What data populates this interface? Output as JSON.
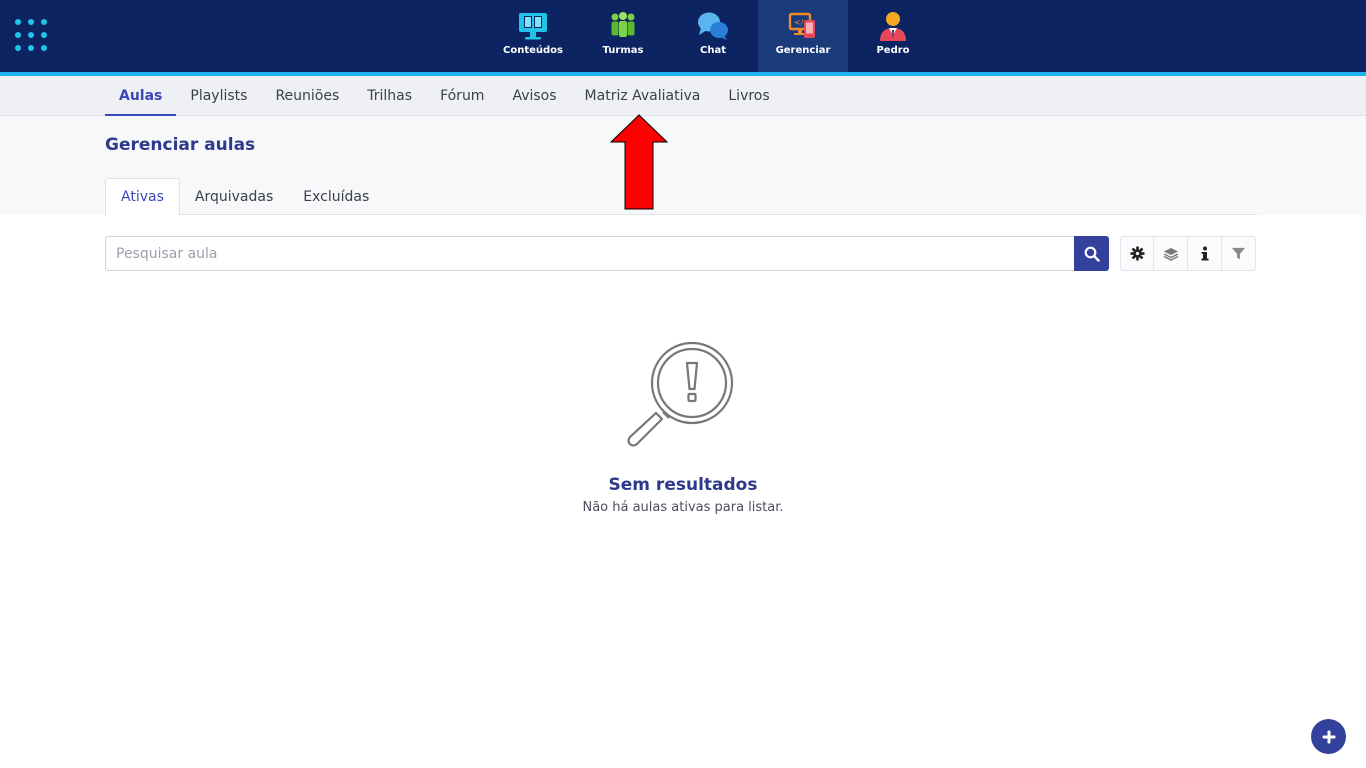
{
  "top_nav": {
    "items": [
      {
        "label": "Conteúdos",
        "icon": "monitor-book-icon",
        "active": false
      },
      {
        "label": "Turmas",
        "icon": "people-group-icon",
        "active": false
      },
      {
        "label": "Chat",
        "icon": "chat-bubbles-icon",
        "active": false
      },
      {
        "label": "Gerenciar",
        "icon": "manage-devices-icon",
        "active": true
      },
      {
        "label": "Pedro",
        "icon": "user-avatar-icon",
        "active": false
      }
    ]
  },
  "sub_nav": {
    "items": [
      {
        "label": "Aulas",
        "active": true
      },
      {
        "label": "Playlists",
        "active": false
      },
      {
        "label": "Reuniões",
        "active": false
      },
      {
        "label": "Trilhas",
        "active": false
      },
      {
        "label": "Fórum",
        "active": false
      },
      {
        "label": "Avisos",
        "active": false
      },
      {
        "label": "Matriz Avaliativa",
        "active": false
      },
      {
        "label": "Livros",
        "active": false
      }
    ]
  },
  "page": {
    "title": "Gerenciar aulas",
    "tabs": [
      {
        "label": "Ativas",
        "active": true
      },
      {
        "label": "Arquivadas",
        "active": false
      },
      {
        "label": "Excluídas",
        "active": false
      }
    ]
  },
  "search": {
    "placeholder": "Pesquisar aula",
    "value": ""
  },
  "toolbar": {
    "icons": [
      "gear-icon",
      "layers-icon",
      "info-icon",
      "filter-icon"
    ]
  },
  "empty_state": {
    "title": "Sem resultados",
    "message": "Não há aulas ativas para listar."
  },
  "colors": {
    "topbar": "#0c2461",
    "accent": "#21b3f0",
    "primary": "#33409c",
    "annotation_arrow": "#ff0000"
  }
}
